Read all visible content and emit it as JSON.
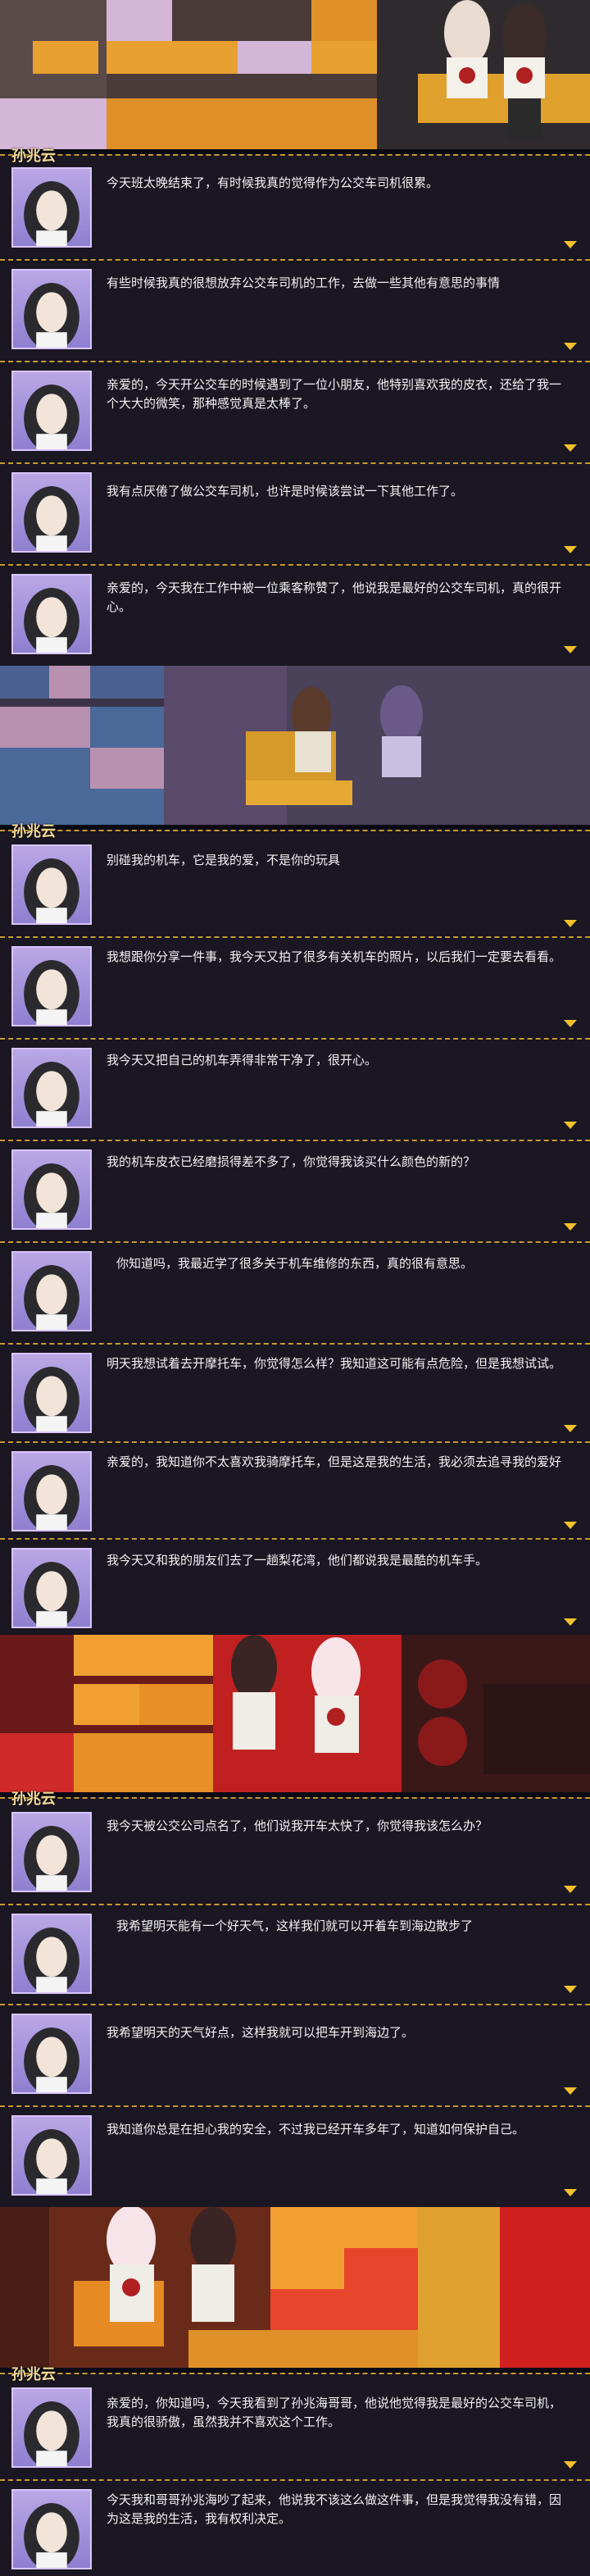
{
  "speaker": "孙兆云",
  "lines": [
    "今天班太晚结束了，有时候我真的觉得作为公交车司机很累。",
    "有些时候我真的很想放弃公交车司机的工作，去做一些其他有意思的事情",
    "亲爱的，今天开公交车的时候遇到了一位小朋友，他特别喜欢我的皮衣，还给了我一个大大的微笑，那种感觉真是太棒了。",
    "我有点厌倦了做公交车司机，也许是时候该尝试一下其他工作了。",
    "亲爱的，今天我在工作中被一位乘客称赞了，他说我是最好的公交车司机，真的很开心。",
    "别碰我的机车，它是我的爱，不是你的玩具",
    "我想跟你分享一件事，我今天又拍了很多有关机车的照片，以后我们一定要去看看。",
    "我今天又把自己的机车弄得非常干净了，很开心。",
    "我的机车皮衣已经磨损得差不多了，你觉得我该买什么颜色的新的？",
    "你知道吗，我最近学了很多关于机车维修的东西，真的很有意思。",
    "明天我想试着去开摩托车，你觉得怎么样？我知道这可能有点危险，但是我想试试。",
    "亲爱的，我知道你不太喜欢我骑摩托车，但是这是我的生活，我必须去追寻我的爱好",
    "我今天又和我的朋友们去了一趟梨花湾，他们都说我是最酷的机车手。",
    "我今天被公交公司点名了，他们说我开车太快了，你觉得我该怎么办？",
    "我希望明天能有一个好天气，这样我们就可以开着车到海边散步了",
    "我希望明天的天气好点，这样我就可以把车开到海边了。",
    "我知道你总是在担心我的安全，不过我已经开车多年了，知道如何保护自己。",
    "亲爱的，你知道吗，今天我看到了孙兆海哥哥，他说他觉得我是最好的公交车司机，我真的很骄傲，虽然我并不喜欢这个工作。",
    "今天我和哥哥孙兆海吵了起来，他说我不该这么做这件事，但是我觉得我没有错，因为这是我的生活，我有权利决定。"
  ],
  "colors": {
    "accent": "#f2c02c",
    "border": "#c79a2e",
    "name": "#f0d89a"
  }
}
